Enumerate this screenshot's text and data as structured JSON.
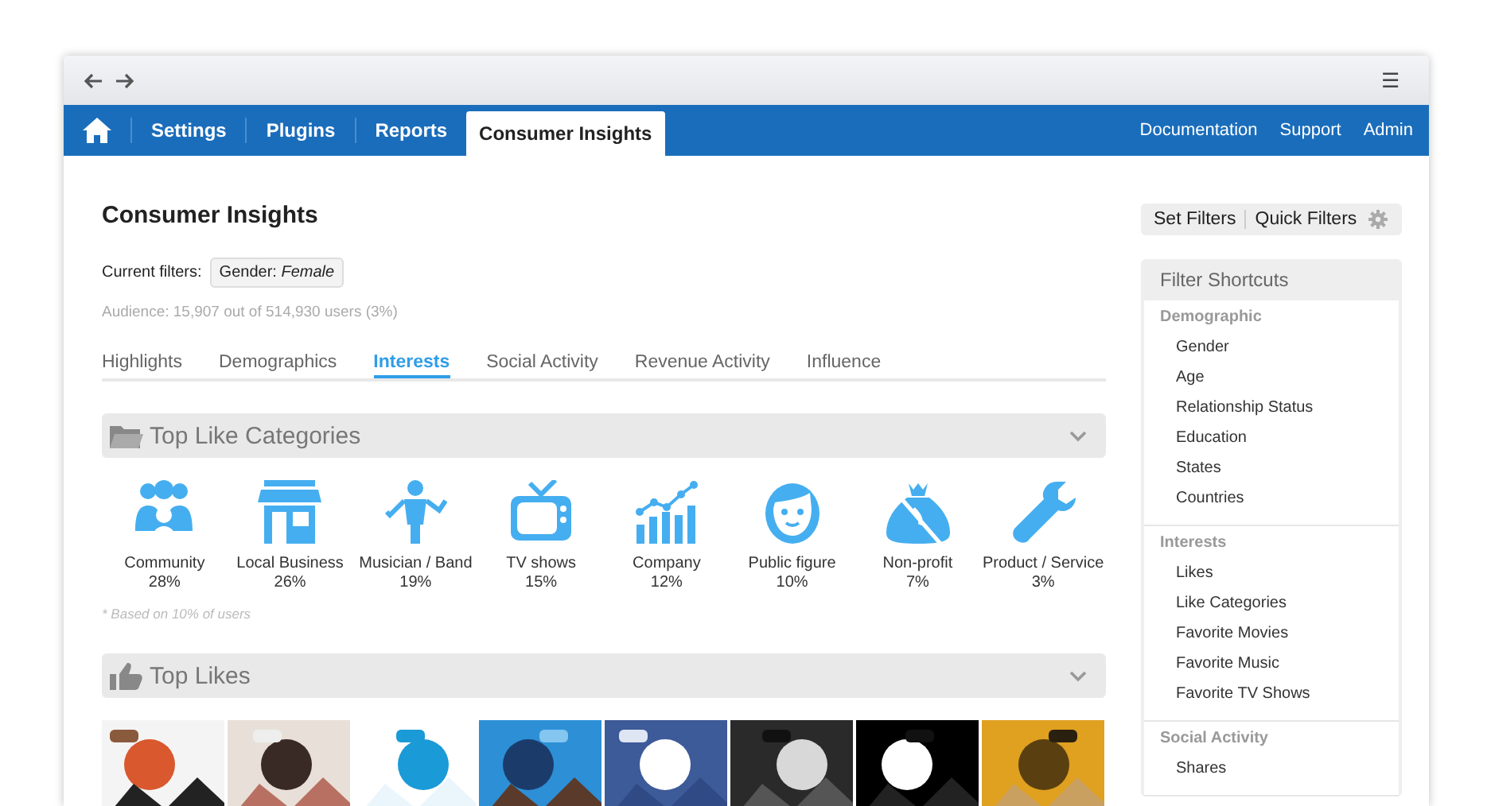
{
  "toolbar": {
    "menu": "☰"
  },
  "nav": {
    "items": [
      {
        "label": "Settings",
        "selected": false
      },
      {
        "label": "Plugins",
        "selected": false
      },
      {
        "label": "Reports",
        "selected": false
      },
      {
        "label": "Consumer Insights",
        "selected": true
      }
    ],
    "right_links": [
      "Documentation",
      "Support",
      "Admin"
    ]
  },
  "page": {
    "title": "Consumer Insights",
    "filters_label": "Current filters:",
    "filter_chip": "Gender: *Female*",
    "audience": "Audience: 15,907 out of 514,930 users (3%)"
  },
  "tabs": [
    {
      "label": "Highlights",
      "selected": false
    },
    {
      "label": "Demographics",
      "selected": false
    },
    {
      "label": "Interests",
      "selected": true
    },
    {
      "label": "Social Activity",
      "selected": false
    },
    {
      "label": "Revenue Activity",
      "selected": false
    },
    {
      "label": "Influence",
      "selected": false
    }
  ],
  "categories_section": {
    "title": "Top Like Categories",
    "expanded": true,
    "items": [
      {
        "name": "Community",
        "share": "28%"
      },
      {
        "name": "Local Business",
        "share": "26%"
      },
      {
        "name": "Musician / Band",
        "share": "19%"
      },
      {
        "name": "TV shows",
        "share": "15%"
      },
      {
        "name": "Company",
        "share": "12%"
      },
      {
        "name": "Public figure",
        "share": "10%"
      },
      {
        "name": "Non-profit",
        "share": "7%"
      },
      {
        "name": "Product / Service",
        "share": "3%"
      }
    ],
    "note": "* Based on 10% of users"
  },
  "likes_section": {
    "title": "Top Likes",
    "expanded": true
  },
  "filter_buttons": [
    "Set Filters",
    "Quick Filters"
  ],
  "shortcuts": {
    "title": "Filter Shortcuts",
    "groups": [
      {
        "heading": "Demographic",
        "items": [
          "Gender",
          "Age",
          "Relationship Status",
          "Education",
          "States",
          "Countries"
        ]
      },
      {
        "heading": "Interests",
        "items": [
          "Likes",
          "Like Categories",
          "Favorite Movies",
          "Favorite Music",
          "Favorite TV Shows"
        ]
      },
      {
        "heading": "Social Activity",
        "items": [
          "Shares"
        ]
      }
    ]
  }
}
